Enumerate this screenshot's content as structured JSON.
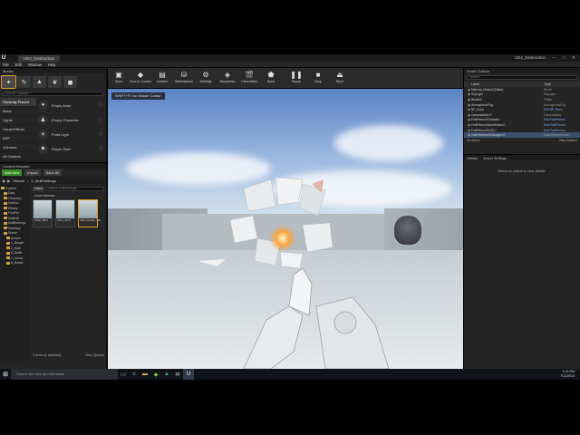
{
  "window": {
    "doc_tab": "UE4_Destruction",
    "project_name": "UE4_Destruction",
    "min": "–",
    "max": "□",
    "close": "✕"
  },
  "menu": [
    "File",
    "Edit",
    "Window",
    "Help"
  ],
  "modes": {
    "title": "Modes",
    "search_placeholder": "Search Classes",
    "categories": [
      "Recently Placed",
      "Basic",
      "Lights",
      "Visual Effects",
      "BSP",
      "Volumes",
      "All Classes"
    ],
    "items": [
      {
        "label": "Empty Actor"
      },
      {
        "label": "Empty Character"
      },
      {
        "label": "Point Light"
      },
      {
        "label": "Player Start"
      }
    ]
  },
  "content_browser": {
    "title": "Content Browser",
    "add_new": "Add New",
    "import": "Import",
    "save_all": "Save All",
    "path": [
      "Stream",
      "2_MultiSettings"
    ],
    "filters": "Filters",
    "search_placeholder": "Search MultiSettings",
    "tree": [
      "Content",
      "Data",
      "Geometry",
      "Destruc",
      "Effects",
      "FirstPer",
      "Material",
      "MultiSettings",
      "Mannequ",
      "Starter",
      "Stream",
      "1_Simple",
      "2_Multi",
      "3_Settin",
      "4_Advan",
      "5_Radial"
    ],
    "section": "Asset Meshes",
    "assets": [
      {
        "name": "Chair_BOX",
        "selected": false
      },
      {
        "name": "Floor_BOX",
        "selected": false
      },
      {
        "name": "Wall_Double_DM",
        "selected": true
      }
    ],
    "status": "3 items (1 selected)",
    "view_options": "View Options"
  },
  "toolbar": [
    {
      "label": "Save",
      "icon": "▣"
    },
    {
      "label": "Source Control",
      "icon": "◆"
    },
    {
      "label": "Content",
      "icon": "▤"
    },
    {
      "label": "Marketplace",
      "icon": "⛁"
    },
    {
      "label": "Settings",
      "icon": "⚙"
    },
    {
      "label": "Blueprints",
      "icon": "◈"
    },
    {
      "label": "Cinematics",
      "icon": "🎬"
    },
    {
      "label": "Build",
      "icon": "⬟"
    },
    {
      "label": "Pause",
      "icon": "❚❚"
    },
    {
      "label": "Stop",
      "icon": "■"
    },
    {
      "label": "Eject",
      "icon": "⏏"
    }
  ],
  "viewport": {
    "label": "SHIFT+F1 for Mouse Cursor"
  },
  "outliner": {
    "title": "World Outliner",
    "search_placeholder": "Search...",
    "col_label": "Label",
    "col_type": "Type",
    "rows": [
      {
        "label": "Minimal_Default (Editor)",
        "type": "World",
        "link": false,
        "selected": false
      },
      {
        "label": "SkyLight",
        "type": "SkyLight",
        "link": false,
        "selected": false
      },
      {
        "label": "Border3",
        "type": "Folder",
        "link": false,
        "selected": false
      },
      {
        "label": "AtmosphericFog",
        "type": "AtmosphericFog",
        "link": false,
        "selected": false
      },
      {
        "label": "BP_Rock",
        "type": "Edit BP_Rock",
        "link": true,
        "selected": false
      },
      {
        "label": "CameraActor17",
        "type": "CameraActor",
        "link": false,
        "selected": false
      },
      {
        "label": "FirstPersonCharacter",
        "type": "Edit FirstPerson",
        "link": true,
        "selected": false
      },
      {
        "label": "FirstPersonGameMode17",
        "type": "Edit FirstPerson",
        "link": true,
        "selected": false
      },
      {
        "label": "FirstPersonHUD17",
        "type": "Edit FirstPerson",
        "link": true,
        "selected": false
      },
      {
        "label": "GameNetworkManager17",
        "type": "GameNetworkMan",
        "link": false,
        "selected": true
      }
    ],
    "status": "28 actors",
    "view_options": "View Options"
  },
  "details": {
    "title": "Details",
    "tab2": "World Settings",
    "empty_msg": "Select an object to view details."
  },
  "taskbar": {
    "search": "Search the web and Windows",
    "time": "1:22 PM",
    "date": "7/11/2015"
  }
}
